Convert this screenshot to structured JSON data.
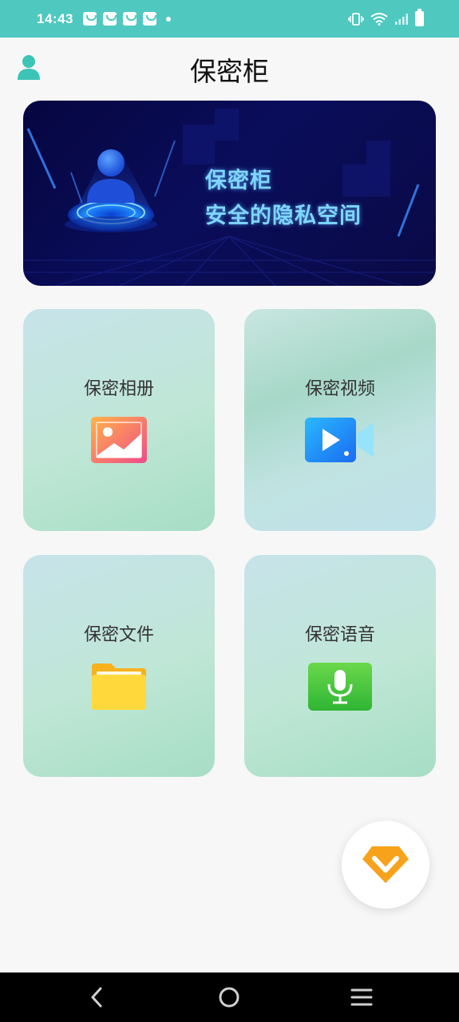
{
  "status_bar": {
    "time": "14:43",
    "notification_icons": [
      "shopping-bag-icon",
      "shopping-bag-icon",
      "shopping-bag-icon",
      "shopping-bag-icon"
    ],
    "right_icons": [
      "vibrate-icon",
      "wifi-icon",
      "signal-icon",
      "battery-icon"
    ]
  },
  "header": {
    "title": "保密柜",
    "left_icon": "user-icon"
  },
  "banner": {
    "line1": "保密柜",
    "line2": "安全的隐私空间"
  },
  "cards": [
    {
      "label": "保密相册",
      "icon": "photo-album-icon"
    },
    {
      "label": "保密视频",
      "icon": "video-icon"
    },
    {
      "label": "保密文件",
      "icon": "folder-icon"
    },
    {
      "label": "保密语音",
      "icon": "microphone-icon"
    }
  ],
  "vip_button": {
    "icon": "vip-diamond-icon"
  },
  "nav_bar": {
    "buttons": [
      "back-icon",
      "home-icon",
      "recent-apps-icon"
    ]
  },
  "colors": {
    "accent": "#4fc8c0",
    "vip": "#f7a21a"
  }
}
